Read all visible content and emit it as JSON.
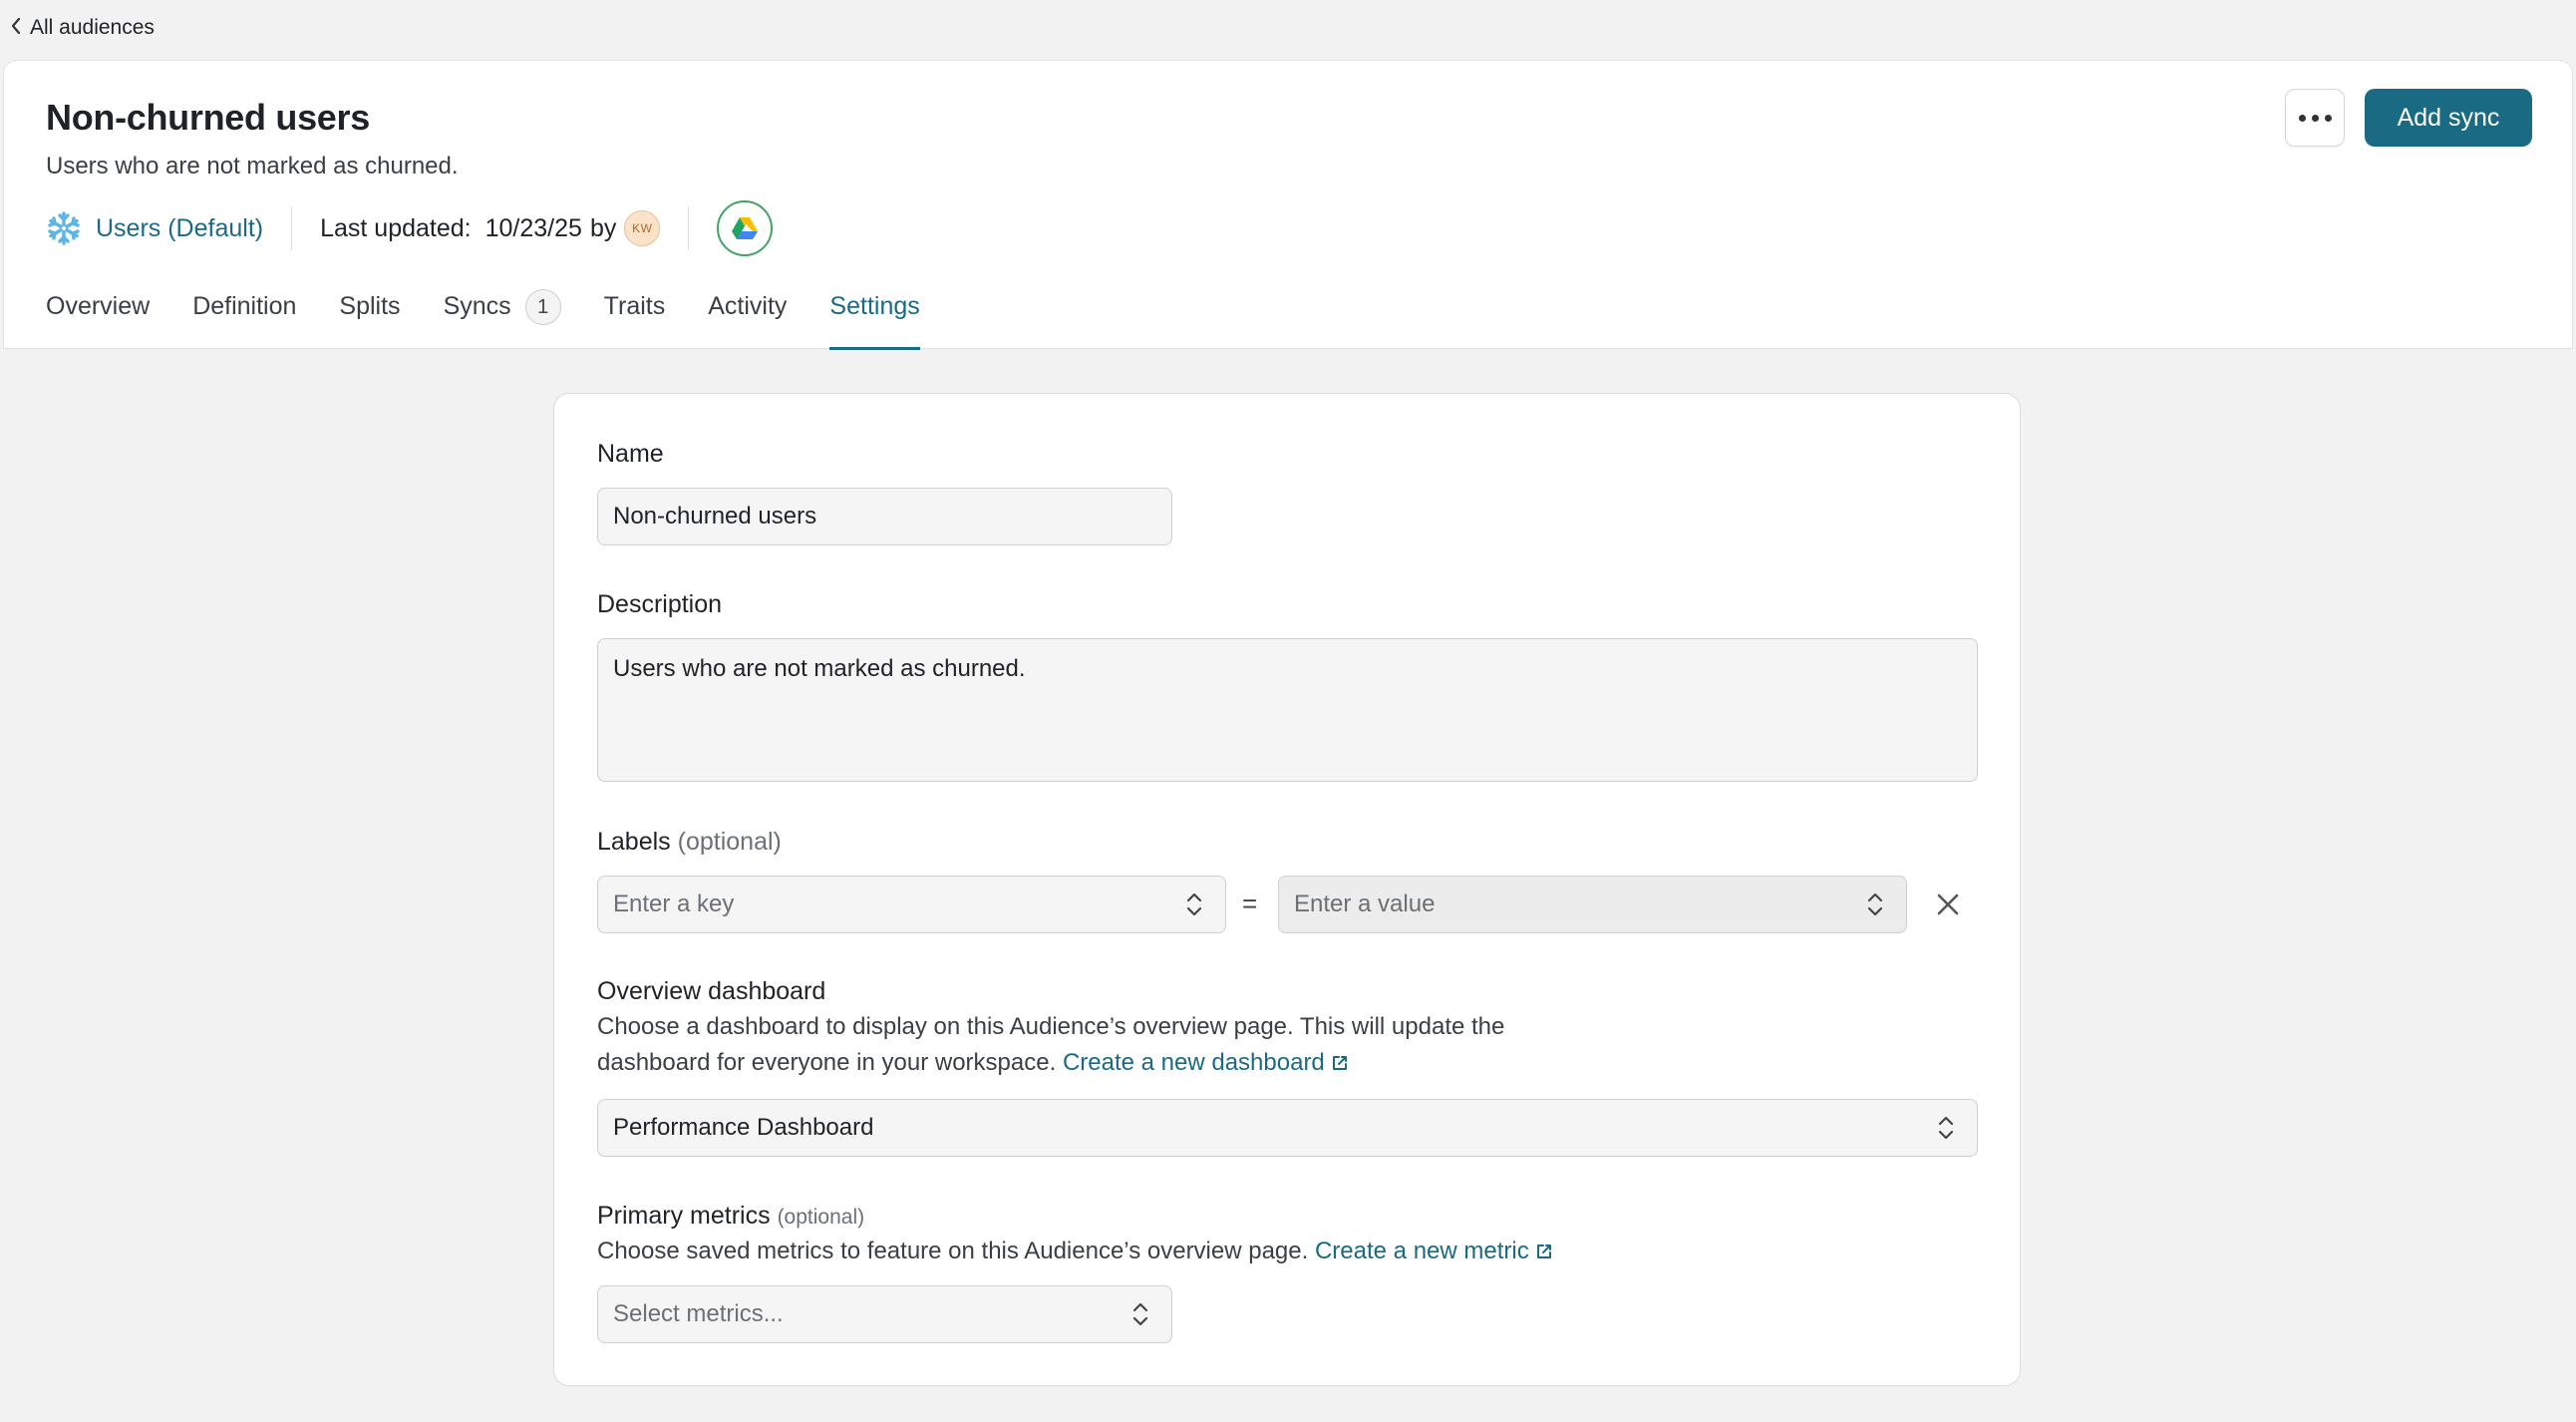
{
  "nav": {
    "back_label": "All audiences"
  },
  "header": {
    "title": "Non-churned users",
    "subtitle": "Users who are not marked as churned.",
    "model_label": "Users (Default)",
    "last_updated_label": "Last updated:",
    "last_updated_date": "10/23/25",
    "by_label": "by",
    "avatar_initials": "KW",
    "add_sync_label": "Add sync"
  },
  "tabs": [
    {
      "label": "Overview"
    },
    {
      "label": "Definition"
    },
    {
      "label": "Splits"
    },
    {
      "label": "Syncs",
      "count": "1"
    },
    {
      "label": "Traits"
    },
    {
      "label": "Activity"
    },
    {
      "label": "Settings",
      "active": true
    }
  ],
  "settings": {
    "name_label": "Name",
    "name_value": "Non-churned users",
    "description_label": "Description",
    "description_value": "Users who are not marked as churned.",
    "labels_label": "Labels",
    "optional": "(optional)",
    "key_placeholder": "Enter a key",
    "equals": "=",
    "value_placeholder": "Enter a value",
    "dashboard_label": "Overview dashboard",
    "dashboard_help_1": "Choose a dashboard to display on this Audience’s overview page. This will update the",
    "dashboard_help_2": "dashboard for everyone in your workspace.",
    "dashboard_link": "Create a new dashboard",
    "dashboard_value": "Performance Dashboard",
    "metrics_label": "Primary metrics",
    "metrics_help": "Choose saved metrics to feature on this Audience’s overview page.",
    "metrics_link": "Create a new metric",
    "metrics_placeholder": "Select metrics..."
  },
  "colors": {
    "accent": "#1a6a84",
    "background": "#f2f2f2",
    "card": "#ffffff"
  },
  "icons": {
    "back": "chevron-left-icon",
    "model": "snowflake-icon",
    "destination": "google-drive-icon",
    "more": "ellipsis-icon",
    "select": "chevron-up-down-icon",
    "remove": "close-icon",
    "external": "external-link-icon"
  }
}
